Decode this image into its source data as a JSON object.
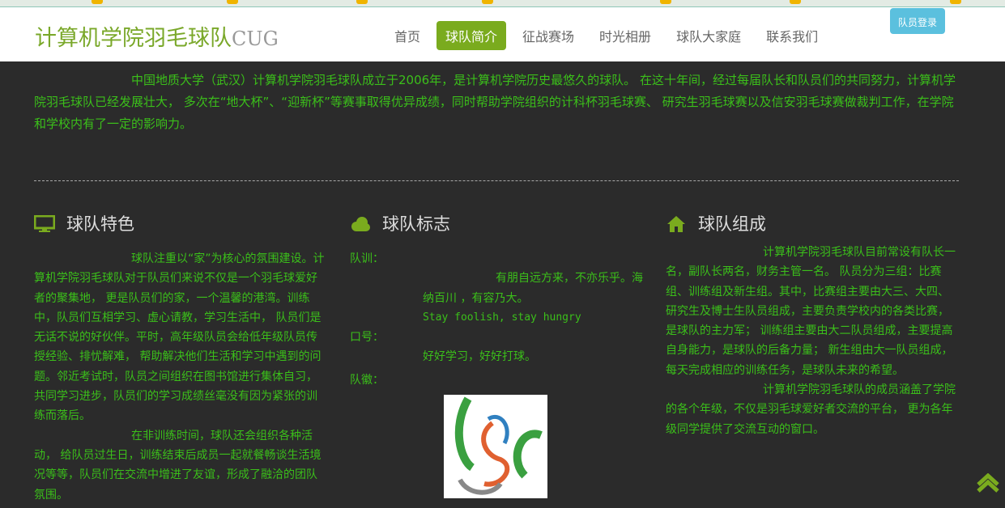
{
  "header": {
    "logo_main": "计算机学院羽毛球队",
    "logo_suffix": "CUG",
    "login": "队员登录",
    "nav": [
      {
        "label": "首页"
      },
      {
        "label": "球队简介",
        "active": true
      },
      {
        "label": "征战赛场"
      },
      {
        "label": "时光相册"
      },
      {
        "label": "球队大家庭"
      },
      {
        "label": "联系我们"
      }
    ]
  },
  "intro": "中国地质大学（武汉）计算机学院羽毛球队成立于2006年，是计算机学院历史最悠久的球队。 在这十年间，经过每届队长和队员们的共同努力，计算机学院羽毛球队已经发展壮大， 多次在“地大杯”、“迎新杯”等赛事取得优异成绩，同时帮助学院组织的计科杯羽毛球赛、 研究生羽毛球赛以及信安羽毛球赛做裁判工作，在学院和学校内有了一定的影响力。",
  "features": {
    "title": "球队特色",
    "icon": "monitor-icon",
    "p1": "球队注重以“家”为核心的氛围建设。计算机学院羽毛球队对于队员们来说不仅是一个羽毛球爱好者的聚集地， 更是队员们的家，一个温馨的港湾。训练中，队员们互相学习、虚心请教，学习生活中， 队员们是无话不说的好伙伴。平时，高年级队员会给低年级队员传授经验、排忧解难， 帮助解决他们生活和学习中遇到的问题。邻近考试时，队员之间组织在图书馆进行集体自习， 共同学习进步，队员们的学习成绩丝毫没有因为紧张的训练而落后。",
    "p2": "在非训练时间，球队还会组织各种活动， 给队员过生日，训练结束后成员一起就餐畅谈生活境况等等，队员们在交流中增进了友谊，形成了融洽的团队氛围。"
  },
  "emblem": {
    "title": "球队标志",
    "icon": "cloud-icon",
    "motto_label": "队训：",
    "motto": "有朋自远方来，不亦乐乎。海纳百川 ，有容乃大。",
    "motto_en": "Stay foolish, stay hungry",
    "slogan_label": "口号：",
    "slogan": "好好学习，好好打球。",
    "badge_label": "队徽："
  },
  "structure": {
    "title": "球队组成",
    "icon": "home-icon",
    "p1": "计算机学院羽毛球队目前常设有队长一名，副队长两名，财务主管一名。 队员分为三组：比赛组、训练组及新生组。其中，比赛组主要由大三、大四、 研究生及博士生队员组成，主要负责学校内的各类比赛，是球队的主力军； 训练组主要由大二队员组成，主要提高自身能力，是球队的后备力量； 新生组由大一队员组成，每天完成相应的训练任务，是球队未来的希望。",
    "p2": "计算机学院羽毛球队的成员涵盖了学院的各个年级，不仅是羽毛球爱好者交流的平台， 更为各年级同学提供了交流互动的窗口。"
  },
  "colors": {
    "accent": "#7aab1e",
    "text": "#3bbf1a",
    "background": "#2b2b2b",
    "login": "#5bc0de"
  }
}
